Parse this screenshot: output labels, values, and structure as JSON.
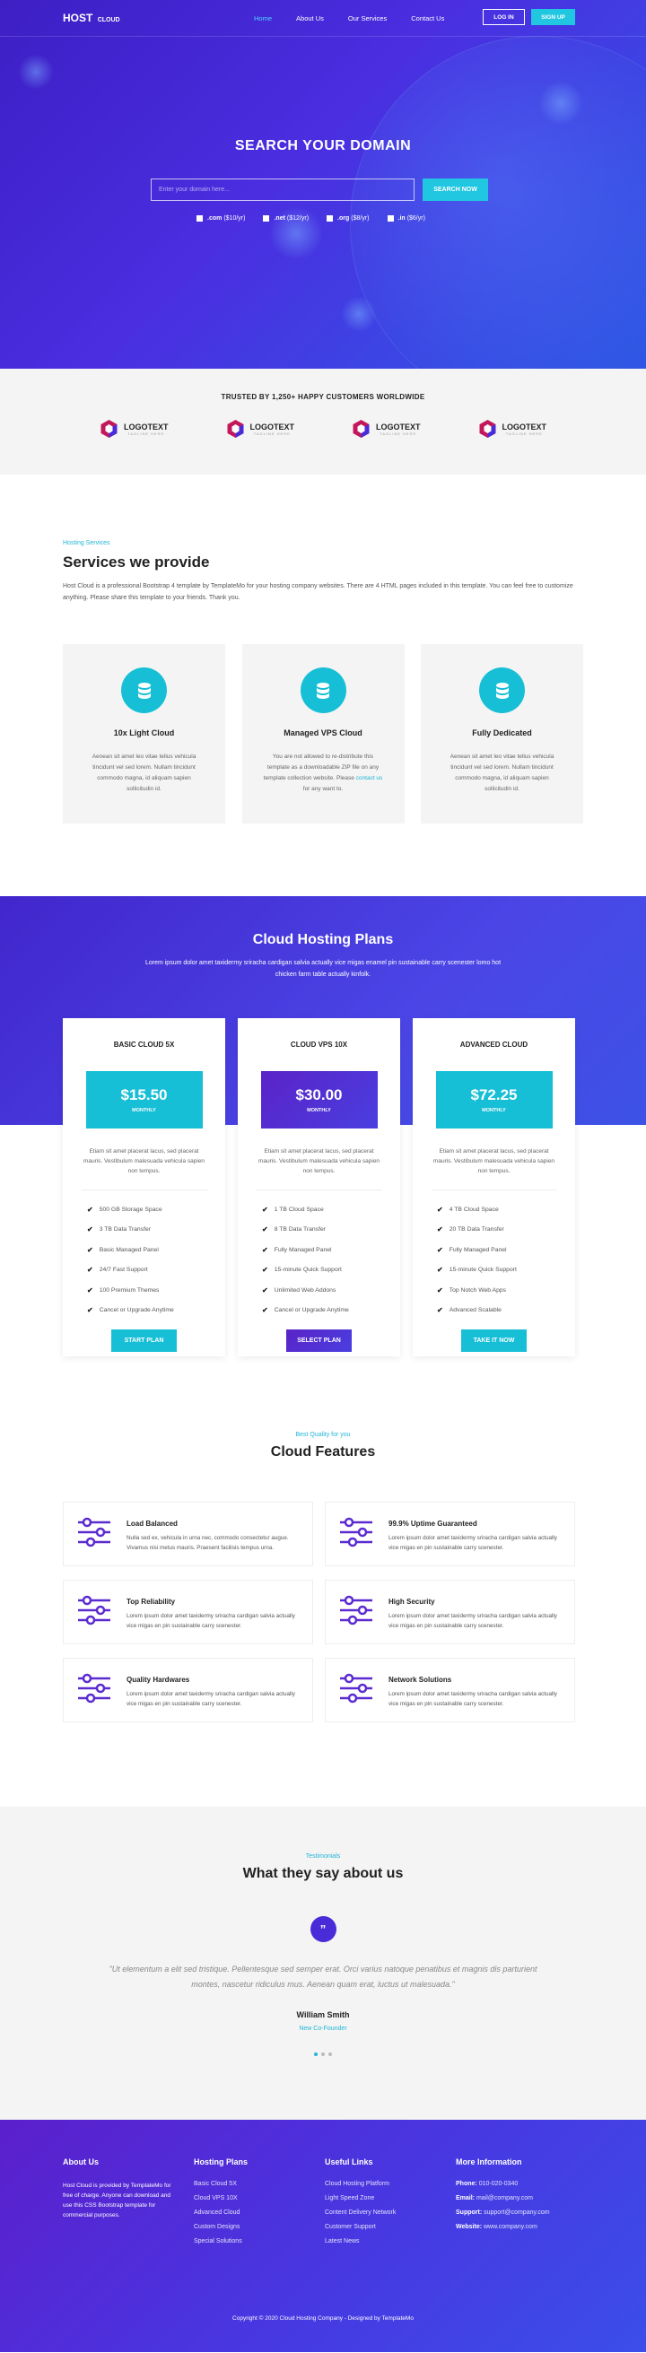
{
  "nav": {
    "logo_main": "HOST",
    "logo_sub": "CLOUD",
    "items": [
      {
        "label": "Home"
      },
      {
        "label": "About Us"
      },
      {
        "label": "Our Services"
      },
      {
        "label": "Contact Us"
      }
    ],
    "login": "LOG IN",
    "signup": "SIGN UP"
  },
  "hero": {
    "title": "SEARCH YOUR DOMAIN",
    "placeholder": "Enter your domain here...",
    "search_button": "SEARCH NOW",
    "tlds": [
      {
        "ext": ".com",
        "price": "($10/yr)"
      },
      {
        "ext": ".net",
        "price": "($12/yr)"
      },
      {
        "ext": ".org",
        "price": "($8/yr)"
      },
      {
        "ext": ".in",
        "price": "($6/yr)"
      }
    ]
  },
  "trusted": {
    "title": "TRUSTED BY 1,250+ HAPPY CUSTOMERS WORLDWIDE",
    "logo_text": "LOGOTEXT",
    "logo_tag": "TAGLINE HERE"
  },
  "services": {
    "eyebrow": "Hosting Services",
    "title": "Services we provide",
    "lead": "Host Cloud is a professional Bootstrap 4 template by TemplateMo for your hosting company websites. There are 4 HTML pages included in this template. You can feel free to customize anything. Please share this template to your friends. Thank you.",
    "cards": [
      {
        "title": "10x Light Cloud",
        "text": "Aenean sit amet leo vitae tellus vehicula tincidunt vel sed lorem. Nullam tincidunt commodo magna, id aliquam sapien sollicitudin id."
      },
      {
        "title": "Managed VPS Cloud",
        "text": "You are not allowed to re-distribute this template as a downloadable ZIP file on any template collection website. Please",
        "link": "contact us",
        "after": "for any want to."
      },
      {
        "title": "Fully Dedicated",
        "text": "Aenean sit amet leo vitae tellus vehicula tincidunt vel sed lorem. Nullam tincidunt commodo magna, id aliquam sapien sollicitudin id."
      }
    ]
  },
  "plans": {
    "title": "Cloud Hosting Plans",
    "lead": "Lorem ipsum dolor amet taxidermy sriracha cardigan salvia actually vice migas enamel pin sustainable carry scenester lomo hot chicken farm table actually kinfolk.",
    "cards": [
      {
        "name": "BASIC CLOUD 5X",
        "price": "$15.50",
        "period": "MONTHLY",
        "desc": "Etiam sit amet placerat lacus, sed placerat mauris. Vestibulum malesuada vehicula sapien non tempus.",
        "features": [
          "500 GB Storage Space",
          "3 TB Data Transfer",
          "Basic Managed Panel",
          "24/7 Fast Support",
          "100 Premium Themes",
          "Cancel or Upgrade Anytime"
        ],
        "button": "START PLAN",
        "color": "#16bfd6"
      },
      {
        "name": "CLOUD VPS 10X",
        "price": "$30.00",
        "period": "MONTHLY",
        "desc": "Etiam sit amet placerat lacus, sed placerat mauris. Vestibulum malesuada vehicula sapien non tempus.",
        "features": [
          "1 TB Cloud Space",
          "8 TB Data Transfer",
          "Fully Managed Panel",
          "15-minute Quick Support",
          "Unlimited Web Addons",
          "Cancel or Upgrade Anytime"
        ],
        "button": "SELECT PLAN",
        "color": "#5325cf"
      },
      {
        "name": "ADVANCED CLOUD",
        "price": "$72.25",
        "period": "MONTHLY",
        "desc": "Etiam sit amet placerat lacus, sed placerat mauris. Vestibulum malesuada vehicula sapien non tempus.",
        "features": [
          "4 TB Cloud Space",
          "20 TB Data Transfer",
          "Fully Managed Panel",
          "15-minute Quick Support",
          "Top Notch Web Apps",
          "Advanced Scalable"
        ],
        "button": "TAKE IT NOW",
        "color": "#16bfd6"
      }
    ]
  },
  "features": {
    "eyebrow": "Best Quality for you",
    "title": "Cloud Features",
    "items": [
      {
        "title": "Load Balanced",
        "text": "Nulla sed ex, vehicula in urna nec, commodo consectetur augue. Vivamus nisi metus mauris. Praesent facilisis tempus urna."
      },
      {
        "title": "99.9% Uptime Guaranteed",
        "text": "Lorem ipsum dolor amet taxidermy sriracha cardigan salvia actually vice migas en pin sustainable carry scenester."
      },
      {
        "title": "Top Reliability",
        "text": "Lorem ipsum dolor amet taxidermy sriracha cardigan salvia actually vice migas en pin sustainable carry scenester."
      },
      {
        "title": "High Security",
        "text": "Lorem ipsum dolor amet taxidermy sriracha cardigan salvia actually vice migas en pin sustainable carry scenester."
      },
      {
        "title": "Quality Hardwares",
        "text": "Lorem ipsum dolor amet taxidermy sriracha cardigan salvia actually vice migas en pin sustainable carry scenester."
      },
      {
        "title": "Network Solutions",
        "text": "Lorem ipsum dolor amet taxidermy sriracha cardigan salvia actually vice migas en pin sustainable carry scenester."
      }
    ]
  },
  "testimonials": {
    "eyebrow": "Testimonials",
    "title": "What they say about us",
    "quote_mark": "”",
    "quote": "\"Ut elementum a elit sed tristique. Pellentesque sed semper erat. Orci varius natoque penatibus et magnis dis parturient montes, nascetur ridiculus mus. Aenean quam erat, luctus ut malesuada.\"",
    "name": "William Smith",
    "role": "New Co-Founder"
  },
  "footer": {
    "about_title": "About Us",
    "about_text": "Host Cloud is provided by TemplateMo for free of charge. Anyone can download and use this CSS Bootstrap template for commercial purposes.",
    "plans_title": "Hosting Plans",
    "plans": [
      "Basic Cloud 5X",
      "Cloud VPS 10X",
      "Advanced Cloud",
      "Custom Designs",
      "Special Solutions"
    ],
    "links_title": "Useful Links",
    "links": [
      "Cloud Hosting Platform",
      "Light Speed Zone",
      "Content Delivery Network",
      "Customer Support",
      "Latest News"
    ],
    "info_title": "More Information",
    "info": [
      {
        "k": "Phone:",
        "v": "010-020-0340"
      },
      {
        "k": "Email:",
        "v": "mail@company.com"
      },
      {
        "k": "Support:",
        "v": "support@company.com"
      },
      {
        "k": "Website:",
        "v": "www.company.com"
      }
    ],
    "copyright": "Copyright © 2020 Cloud Hosting Company - Designed by TemplateMo"
  },
  "colors": {
    "cyan": "#16bfd6",
    "purple": "#4a2bd8"
  },
  "icons": {
    "service": "database-icon",
    "feature": "sliders-icon",
    "check": "check-icon",
    "quote": "quote-icon"
  }
}
